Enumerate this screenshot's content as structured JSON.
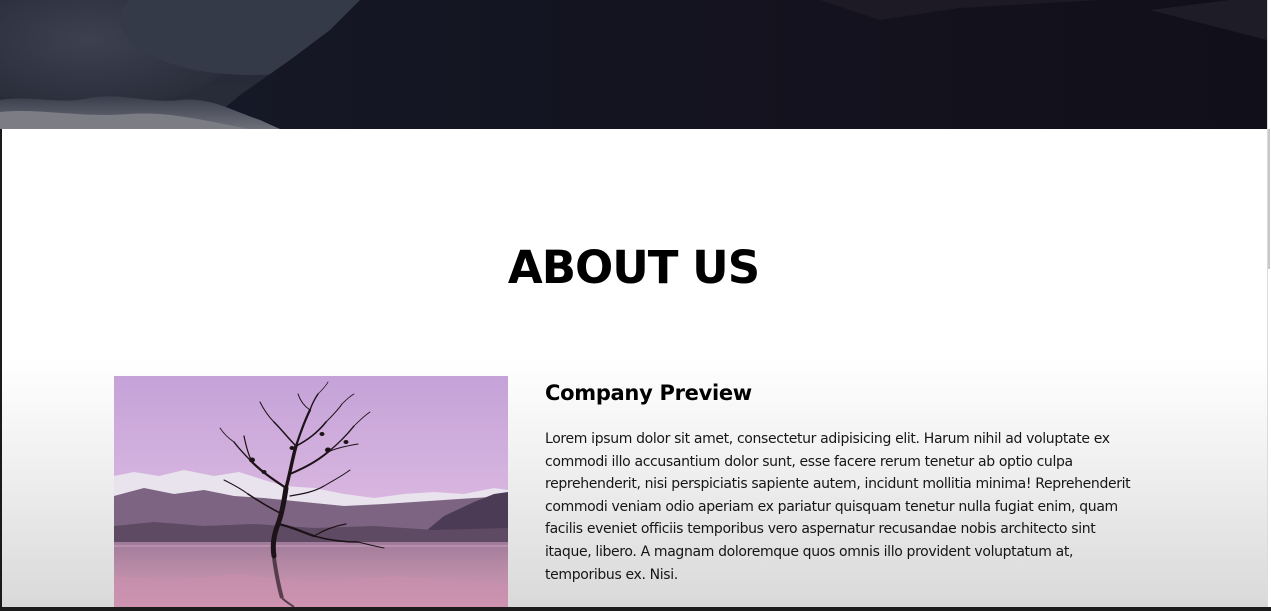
{
  "about": {
    "title": "ABOUT US",
    "image_name": "tree-in-lake-photo"
  },
  "company_preview": {
    "heading": "Company Preview",
    "body": "Lorem ipsum dolor sit amet, consectetur adipisicing elit. Harum nihil ad voluptate ex commodi illo accusantium dolor sunt, esse facere rerum tenetur ab optio culpa reprehenderit, nisi perspiciatis sapiente autem, incidunt mollitia minima! Reprehenderit commodi veniam odio aperiam ex pariatur quisquam tenetur nulla fugiat enim, quam facilis eveniet officiis temporibus vero aspernatur recusandae nobis architecto sint itaque, libero. A magnam doloremque quos omnis illo provident voluptatum at, temporibus ex. Nisi."
  },
  "colors": {
    "hero_dark": "#141520",
    "title_text": "#000000",
    "body_text": "#161616",
    "section_bottom": "#d9d9d9"
  }
}
